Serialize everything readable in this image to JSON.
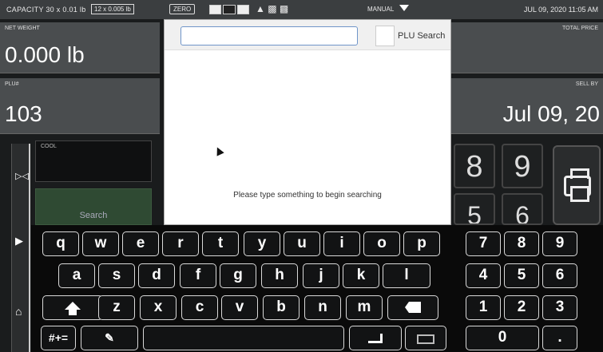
{
  "status_bar": {
    "capacity": "CAPACITY  30 x 0.01 lb",
    "capacity_alt": "12 x 0.005 lb",
    "zero": "ZERO",
    "mode": "MANUAL",
    "datetime": "JUL 09, 2020 11:05 AM"
  },
  "panels": {
    "net_weight_label": "NET WEIGHT",
    "net_weight_value": "0.000 lb",
    "total_price_label": "TOTAL PRICE",
    "plu_label": "PLU#",
    "plu_value": "103",
    "sell_by_label": "SELL BY",
    "sell_by_value": "Jul 09, 20",
    "cool_label": "COOL",
    "search_label": "Search"
  },
  "keypad_peek": {
    "k8": "8",
    "k9": "9",
    "k5": "5",
    "k6": "6"
  },
  "search_dialog": {
    "query": "",
    "plu_search_label": "PLU Search",
    "empty_message": "Please type something to begin searching"
  },
  "keyboard": {
    "row1": [
      "q",
      "w",
      "e",
      "r",
      "t",
      "y",
      "u",
      "i",
      "o",
      "p"
    ],
    "row2": [
      "a",
      "s",
      "d",
      "f",
      "g",
      "h",
      "j",
      "k",
      "l"
    ],
    "row3": [
      "z",
      "x",
      "c",
      "v",
      "b",
      "n",
      "m"
    ],
    "symbols_label": "#+=",
    "numpad": [
      "7",
      "8",
      "9",
      "4",
      "5",
      "6",
      "1",
      "2",
      "3",
      "0",
      "."
    ]
  },
  "icons": [
    "settings-icon",
    "home-icon",
    "print-icon",
    "shift-icon",
    "backspace-icon",
    "enter-icon",
    "hide-keyboard-icon",
    "paste-icon"
  ]
}
